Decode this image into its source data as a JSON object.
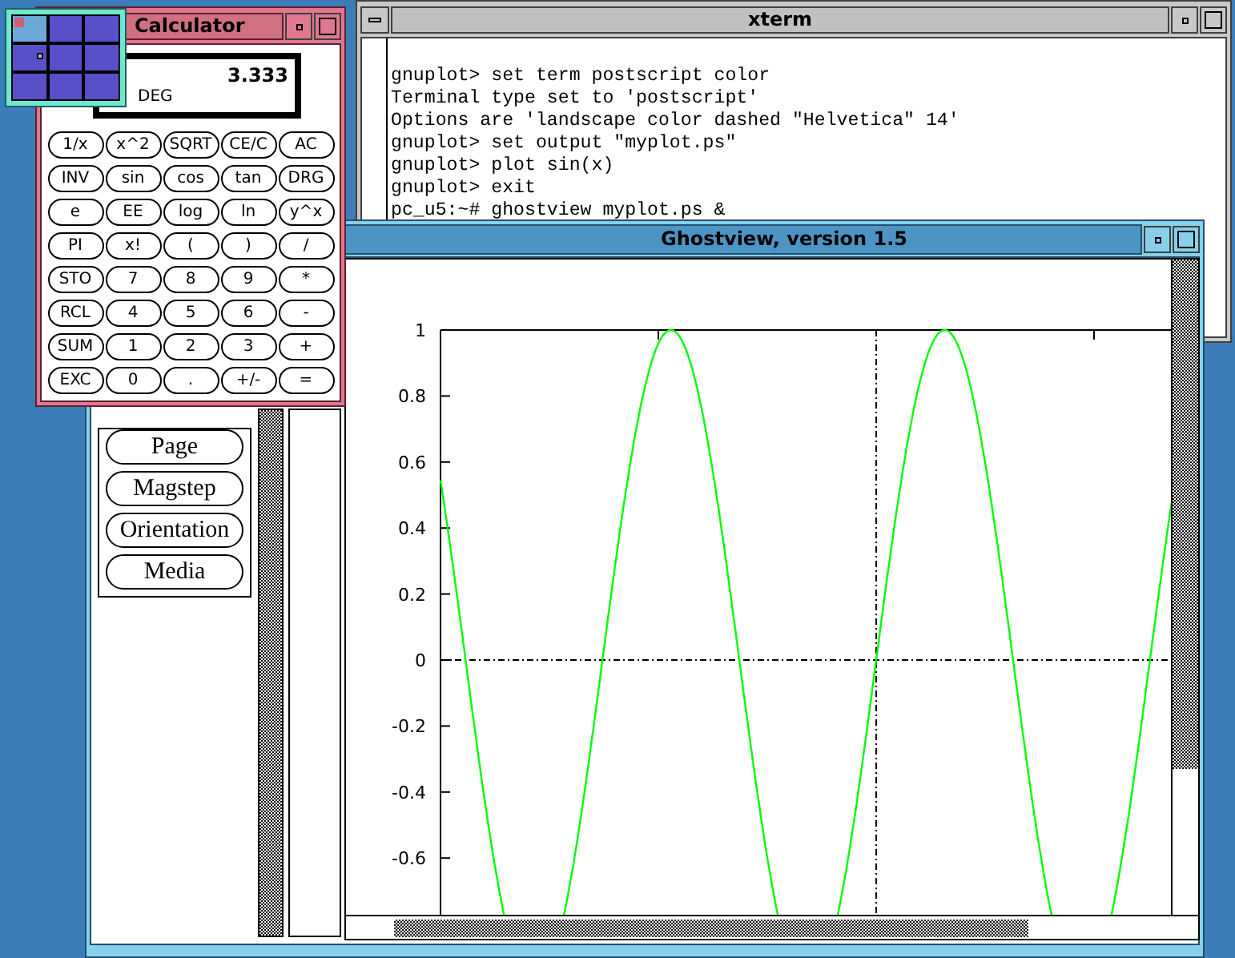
{
  "calculator": {
    "title": "Calculator",
    "display": "3.333",
    "mode": "DEG",
    "keys": [
      [
        "1/x",
        "x^2",
        "SQRT",
        "CE/C",
        "AC"
      ],
      [
        "INV",
        "sin",
        "cos",
        "tan",
        "DRG"
      ],
      [
        "e",
        "EE",
        "log",
        "ln",
        "y^x"
      ],
      [
        "PI",
        "x!",
        "(",
        ")",
        "/"
      ],
      [
        "STO",
        "7",
        "8",
        "9",
        "*"
      ],
      [
        "RCL",
        "4",
        "5",
        "6",
        "-"
      ],
      [
        "SUM",
        "1",
        "2",
        "3",
        "+"
      ],
      [
        "EXC",
        "0",
        ".",
        "+/-",
        "="
      ]
    ]
  },
  "xterm": {
    "title": "xterm",
    "lines": [
      "gnuplot> set term postscript color",
      "Terminal type set to 'postscript'",
      "Options are 'landscape color dashed \"Helvetica\" 14'",
      "gnuplot> set output \"myplot.ps\"",
      "gnuplot> plot sin(x)",
      "gnuplot> exit",
      "pc_u5:~# ghostview myplot.ps &"
    ]
  },
  "ghostview": {
    "title": "Ghostview, version 1.5",
    "buttons": [
      "Page",
      "Magstep",
      "Orientation",
      "Media"
    ],
    "plot": {
      "y_axis_labels": [
        "1",
        "0.8",
        "0.6",
        "0.4",
        "0.2",
        "0",
        "-0.2",
        "-0.4",
        "-0.6"
      ]
    }
  }
}
